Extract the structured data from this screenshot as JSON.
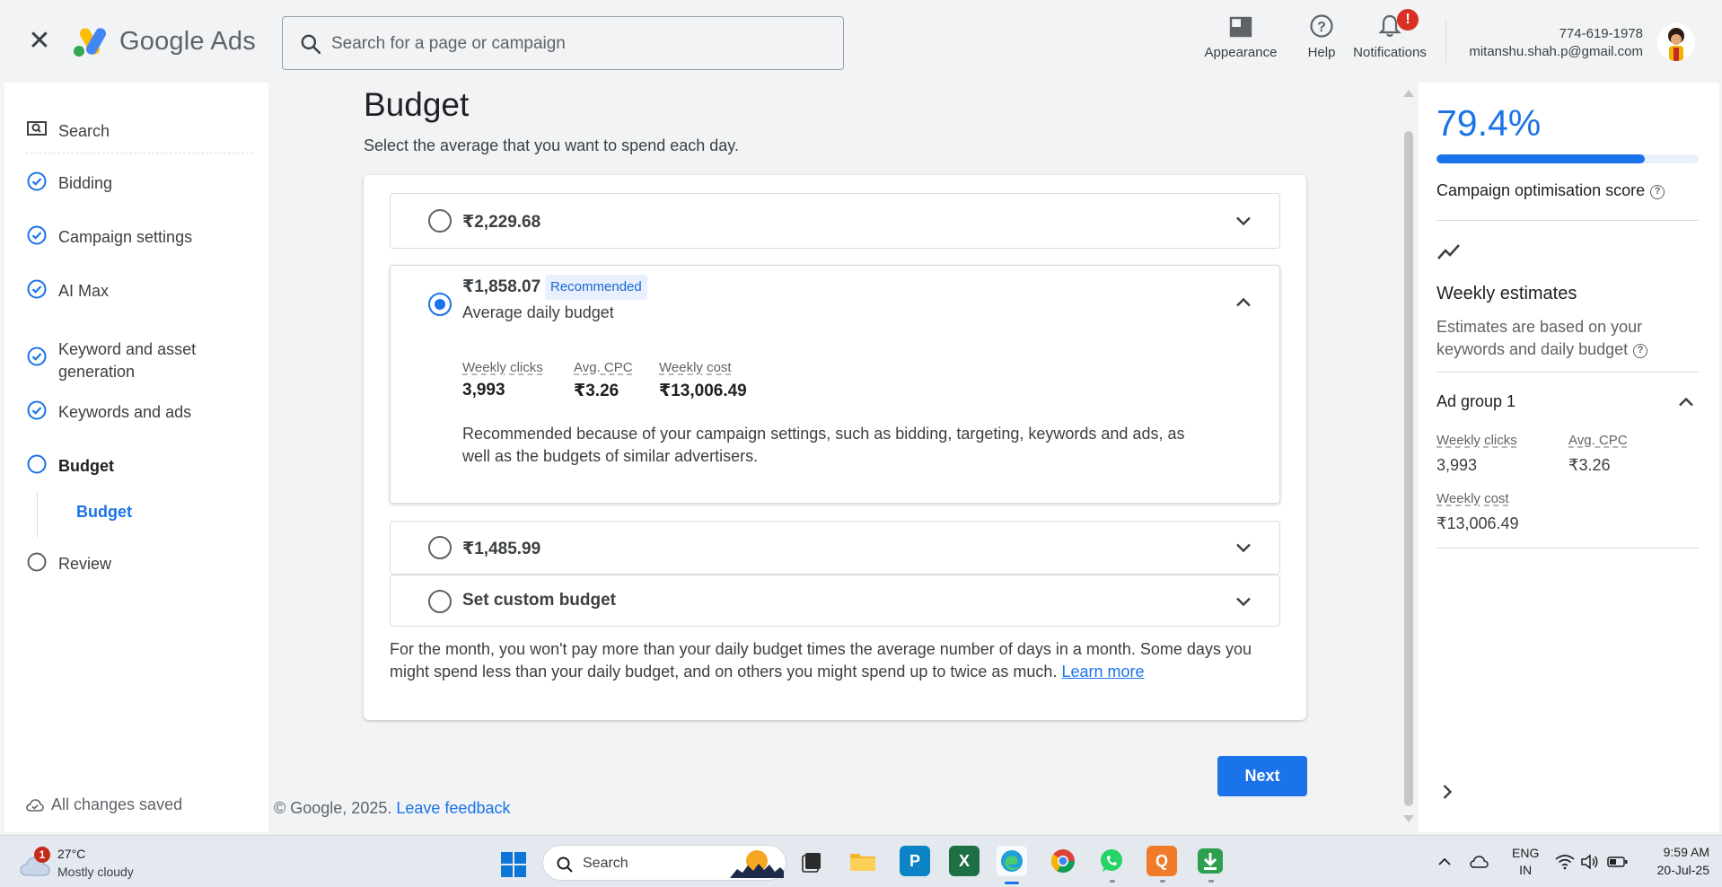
{
  "header": {
    "brand": "Google Ads",
    "search_placeholder": "Search for a page or campaign",
    "actions": {
      "appearance": "Appearance",
      "help": "Help",
      "notifications": "Notifications",
      "notifications_badge": "!"
    },
    "account": {
      "phone": "774-619-1978",
      "email": "mitanshu.shah.p@gmail.com"
    }
  },
  "leftnav": {
    "search": "Search",
    "items": [
      {
        "label": "Bidding",
        "state": "done"
      },
      {
        "label": "Campaign settings",
        "state": "done"
      },
      {
        "label": "AI Max",
        "state": "done"
      },
      {
        "label": "Keyword and asset generation",
        "state": "done"
      },
      {
        "label": "Keywords and ads",
        "state": "done"
      },
      {
        "label": "Budget",
        "state": "current"
      },
      {
        "label": "Review",
        "state": "todo"
      }
    ],
    "sub_item": "Budget",
    "saved_status": "All changes saved"
  },
  "main": {
    "title": "Budget",
    "subtitle": "Select the average that you want to spend each day.",
    "options": [
      {
        "amount": "₹2,229.68",
        "selected": false
      },
      {
        "amount": "₹1,858.07",
        "selected": true,
        "badge": "Recommended",
        "caption": "Average daily budget",
        "stats": [
          {
            "label": "Weekly clicks",
            "value": "3,993"
          },
          {
            "label": "Avg. CPC",
            "value": "₹3.26"
          },
          {
            "label": "Weekly cost",
            "value": "₹13,006.49"
          }
        ],
        "reason": "Recommended because of your campaign settings, such as bidding, targeting, keywords and ads, as well as the budgets of similar advertisers."
      },
      {
        "amount": "₹1,485.99",
        "selected": false
      },
      {
        "amount": "Set custom budget",
        "selected": false
      }
    ],
    "footnote": "For the month, you won't pay more than your daily budget times the average number of days in a month. Some days you might spend less than your daily budget, and on others you might spend up to twice as much.",
    "learn_more": "Learn more",
    "next_label": "Next",
    "copyright": "© Google, 2025.",
    "feedback": "Leave feedback"
  },
  "rightpanel": {
    "score": "79.4%",
    "score_fraction": 0.794,
    "score_label": "Campaign optimisation score",
    "estimates_title": "Weekly estimates",
    "estimates_desc": "Estimates are based on your keywords and daily budget",
    "ad_group": "Ad group 1",
    "stats": {
      "weekly_clicks_label": "Weekly clicks",
      "weekly_clicks": "3,993",
      "avg_cpc_label": "Avg. CPC",
      "avg_cpc": "₹3.26",
      "weekly_cost_label": "Weekly cost",
      "weekly_cost": "₹13,006.49"
    }
  },
  "taskbar": {
    "weather_badge": "1",
    "temperature": "27°C",
    "condition": "Mostly cloudy",
    "search": "Search",
    "language": "ENG",
    "region": "IN",
    "time": "9:59 AM",
    "date": "20-Jul-25"
  },
  "colors": {
    "accent": "#1a73e8",
    "text": "#202124",
    "muted": "#5f6368",
    "badge_bg": "#e8f0fe",
    "alert": "#d93025"
  }
}
